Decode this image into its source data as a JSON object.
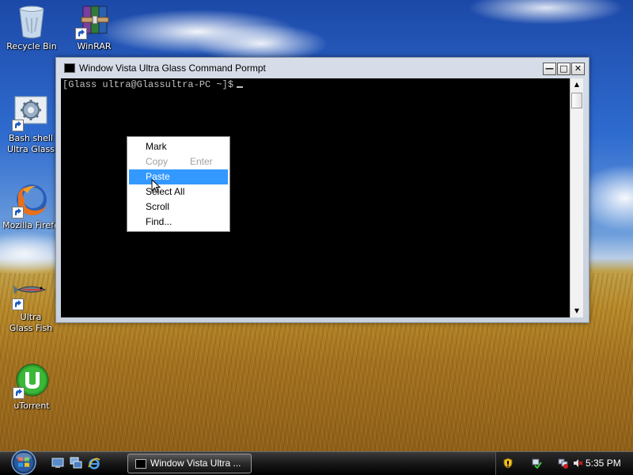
{
  "desktop": {
    "icons": [
      {
        "label": "Recycle Bin"
      },
      {
        "label": "WinRAR"
      },
      {
        "label": "Bash shell Ultra Glass"
      },
      {
        "label": "Mozilla Firefo"
      },
      {
        "label": "Ultra Glass Fish"
      },
      {
        "label": "uTorrent"
      }
    ]
  },
  "window": {
    "title": "Window Vista Ultra Glass Command Pormpt",
    "prompt": "[Glass ultra@Glassultra-PC ~]$",
    "buttons": {
      "minimize": "—",
      "maximize": "□",
      "close": "✕"
    }
  },
  "context_menu": {
    "items": [
      {
        "label": "Mark",
        "shortcut": "",
        "state": "normal"
      },
      {
        "label": "Copy",
        "shortcut": "Enter",
        "state": "disabled"
      },
      {
        "label": "Paste",
        "shortcut": "",
        "state": "highlighted"
      },
      {
        "label": "Select All",
        "shortcut": "",
        "state": "normal"
      },
      {
        "label": "Scroll",
        "shortcut": "",
        "state": "normal"
      },
      {
        "label": "Find...",
        "shortcut": "",
        "state": "normal"
      }
    ]
  },
  "taskbar": {
    "start_icon": "windows-orb-icon",
    "quick_launch": [
      "show-desktop-icon",
      "switch-windows-icon",
      "internet-explorer-icon"
    ],
    "task_button_label": "Window Vista Ultra ...",
    "tray_icons": [
      "security-shield-icon",
      "network-check-icon",
      "network-disconnected-icon",
      "volume-muted-icon"
    ],
    "clock": "5:35 PM"
  },
  "colors": {
    "highlight": "#3399ff",
    "console_bg": "#000000",
    "console_fg": "#c0c0c0"
  }
}
